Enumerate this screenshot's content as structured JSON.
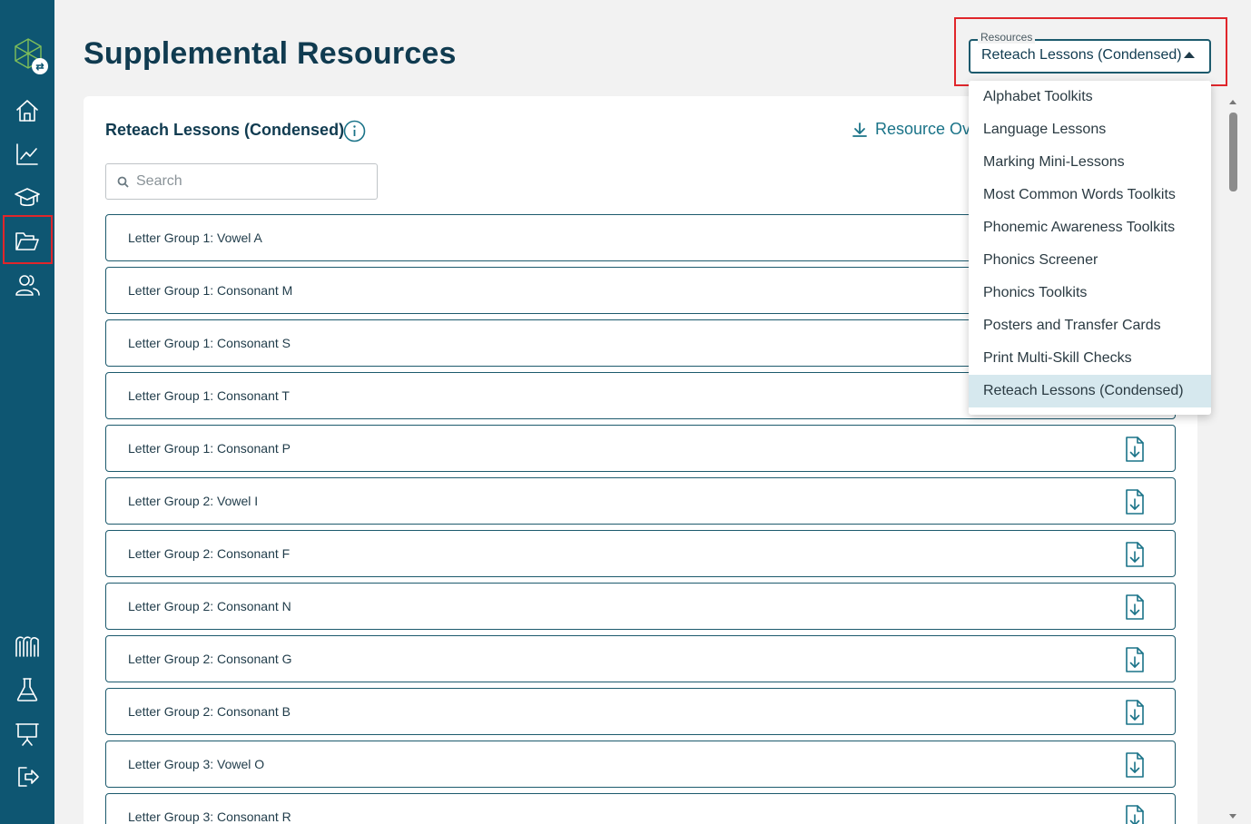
{
  "app": {
    "brand_color": "#0e5672",
    "accent": "#1a7388",
    "highlight": "#e0262b"
  },
  "sidebar": {
    "items": [
      {
        "icon": "home-icon"
      },
      {
        "icon": "chart-icon"
      },
      {
        "icon": "graduation-cap-icon"
      },
      {
        "icon": "folder-icon",
        "active": true
      },
      {
        "icon": "users-icon"
      },
      {
        "icon": "library-icon"
      },
      {
        "icon": "flask-icon"
      },
      {
        "icon": "presentation-icon"
      },
      {
        "icon": "logout-icon"
      }
    ]
  },
  "header": {
    "title": "Supplemental Resources"
  },
  "resource_select": {
    "legend": "Resources",
    "value": "Reteach Lessons (Condensed)",
    "options": [
      "Alphabet Toolkits",
      "Language Lessons",
      "Marking Mini-Lessons",
      "Most Common Words Toolkits",
      "Phonemic Awareness Toolkits",
      "Phonics Screener",
      "Phonics Toolkits",
      "Posters and Transfer Cards",
      "Print Multi-Skill Checks",
      "Reteach Lessons (Condensed)"
    ],
    "selected_index": 9
  },
  "card": {
    "title": "Reteach Lessons (Condensed)",
    "overview_label": "Resource Ove",
    "search_placeholder": "Search"
  },
  "lessons": [
    "Letter Group 1: Vowel A",
    "Letter Group 1: Consonant M",
    "Letter Group 1: Consonant S",
    "Letter Group 1: Consonant T",
    "Letter Group 1: Consonant P",
    "Letter Group 2: Vowel I",
    "Letter Group 2: Consonant F",
    "Letter Group 2: Consonant N",
    "Letter Group 2: Consonant G",
    "Letter Group 2: Consonant B",
    "Letter Group 3: Vowel O",
    "Letter Group 3: Consonant R"
  ]
}
